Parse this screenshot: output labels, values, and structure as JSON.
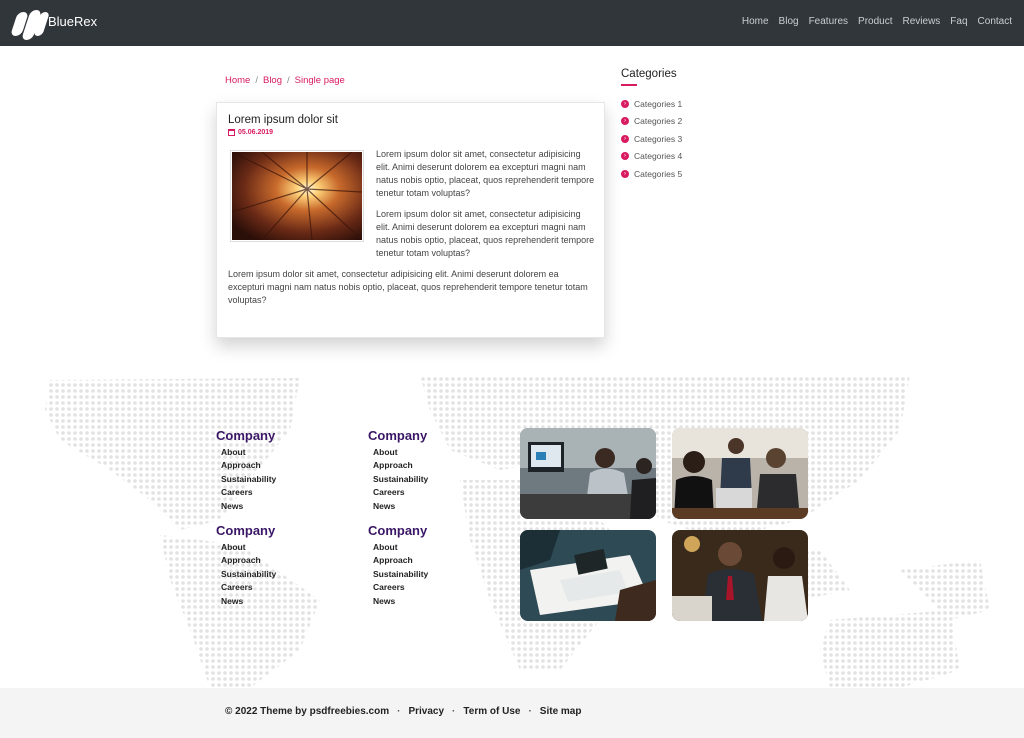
{
  "header": {
    "brand": "BlueRex",
    "nav": [
      "Home",
      "Blog",
      "Features",
      "Product",
      "Reviews",
      "Faq",
      "Contact"
    ]
  },
  "breadcrumb": {
    "items": [
      "Home",
      "Blog",
      "Single page"
    ],
    "separator": "/"
  },
  "post": {
    "title": "Lorem ipsum dolor sit",
    "date": "05.06.2019",
    "paragraphs": [
      "Lorem ipsum dolor sit amet, consectetur adipisicing elit. Animi deserunt dolorem ea excepturi magni nam natus nobis optio, placeat, quos reprehenderit tempore tenetur totam voluptas?",
      "Lorem ipsum dolor sit amet, consectetur adipisicing elit. Animi deserunt dolorem ea excepturi magni nam natus nobis optio, placeat, quos reprehenderit tempore tenetur totam voluptas?",
      "Lorem ipsum dolor sit amet, consectetur adipisicing elit. Animi deserunt dolorem ea excepturi magni nam natus nobis optio, placeat, quos reprehenderit tempore tenetur totam voluptas?"
    ]
  },
  "sidebar": {
    "title": "Categories",
    "categories": [
      "Categories 1",
      "Categories 2",
      "Categories 3",
      "Categories 4",
      "Categories 5"
    ]
  },
  "footer": {
    "columns": [
      {
        "heading": "Company",
        "links": [
          "About",
          "Approach",
          "Sustainability",
          "Careers",
          "News"
        ]
      },
      {
        "heading": "Company",
        "links": [
          "About",
          "Approach",
          "Sustainability",
          "Careers",
          "News"
        ]
      },
      {
        "heading": "Company",
        "links": [
          "About",
          "Approach",
          "Sustainability",
          "Careers",
          "News"
        ]
      },
      {
        "heading": "Company",
        "links": [
          "About",
          "Approach",
          "Sustainability",
          "Careers",
          "News"
        ]
      }
    ],
    "bottom": {
      "copyright": "© 2022 Theme by psdfreebies.com",
      "separator": "·",
      "links": [
        "Privacy",
        "Term of Use",
        "Site map"
      ]
    }
  },
  "colors": {
    "accent": "#d81b60",
    "header_bg": "#31363b",
    "footer_heading": "#3a1766",
    "bottom_bar_bg": "#f4f4f5"
  }
}
